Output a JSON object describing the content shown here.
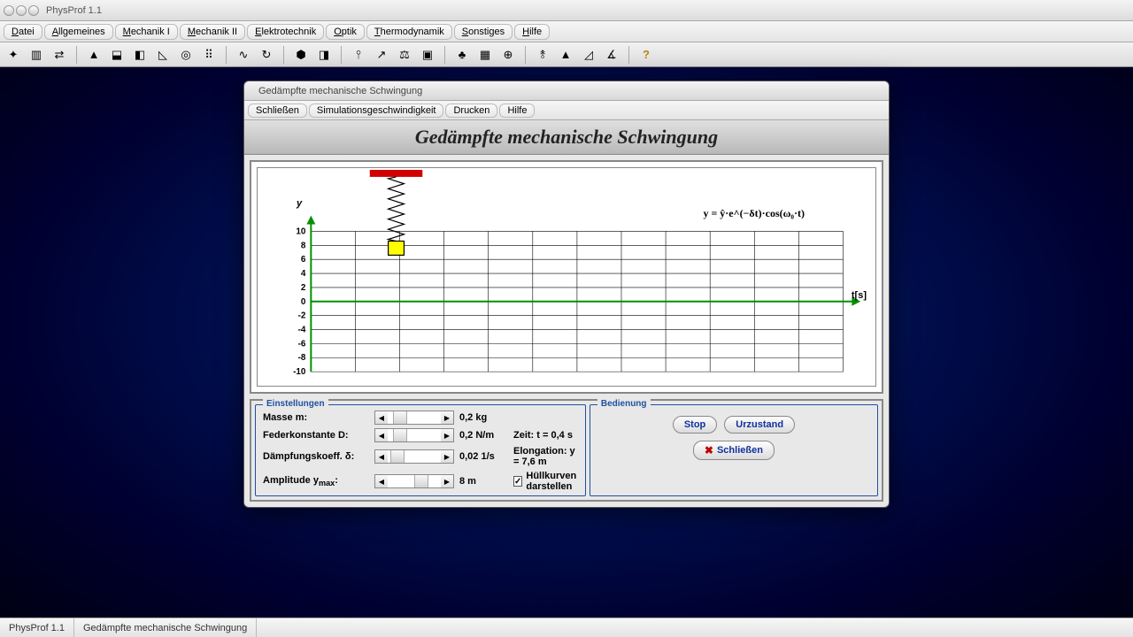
{
  "app_title": "PhysProf 1.1",
  "main_menu": [
    "Datei",
    "Allgemeines",
    "Mechanik I",
    "Mechanik II",
    "Elektrotechnik",
    "Optik",
    "Thermodynamik",
    "Sonstiges",
    "Hilfe"
  ],
  "statusbar": {
    "left": "PhysProf 1.1",
    "right": "Gedämpfte mechanische Schwingung"
  },
  "child": {
    "title": "Gedämpfte mechanische Schwingung",
    "menu": [
      "Schließen",
      "Simulationsgeschwindigkeit",
      "Drucken",
      "Hilfe"
    ],
    "heading": "Gedämpfte mechanische Schwingung"
  },
  "chart_data": {
    "type": "line",
    "title": "Gedämpfte mechanische Schwingung",
    "ylabel": "y",
    "xlabel": "t[s]",
    "ylim": [
      -10,
      10
    ],
    "yticks": [
      10,
      8,
      6,
      4,
      2,
      0,
      -2,
      -4,
      -6,
      -8,
      -10
    ],
    "xgrid_count": 12,
    "formula": "y = ŷ·e^(−δt)·cos(ω₀·t)",
    "mass_y_position": 7.6,
    "spring_anchor_x_fraction": 0.16
  },
  "settings": {
    "legend": "Einstellungen",
    "mass_label": "Masse m:",
    "mass_value": "0,2 kg",
    "spring_label": "Federkonstante D:",
    "spring_value": "0,2 N/m",
    "damp_label": "Dämpfungskoeff. δ:",
    "damp_value": "0,02 1/s",
    "amp_label": "Amplitude y",
    "amp_sub": "max",
    "amp_suffix": ":",
    "amp_value": "8 m",
    "time_label": "Zeit:  t = 0,4 s",
    "elong_label": "Elongation:  y = 7,6 m",
    "envelope_label": "Hüllkurven darstellen",
    "envelope_checked": true
  },
  "controls": {
    "legend": "Bedienung",
    "stop": "Stop",
    "reset": "Urzustand",
    "close": "Schließen"
  }
}
